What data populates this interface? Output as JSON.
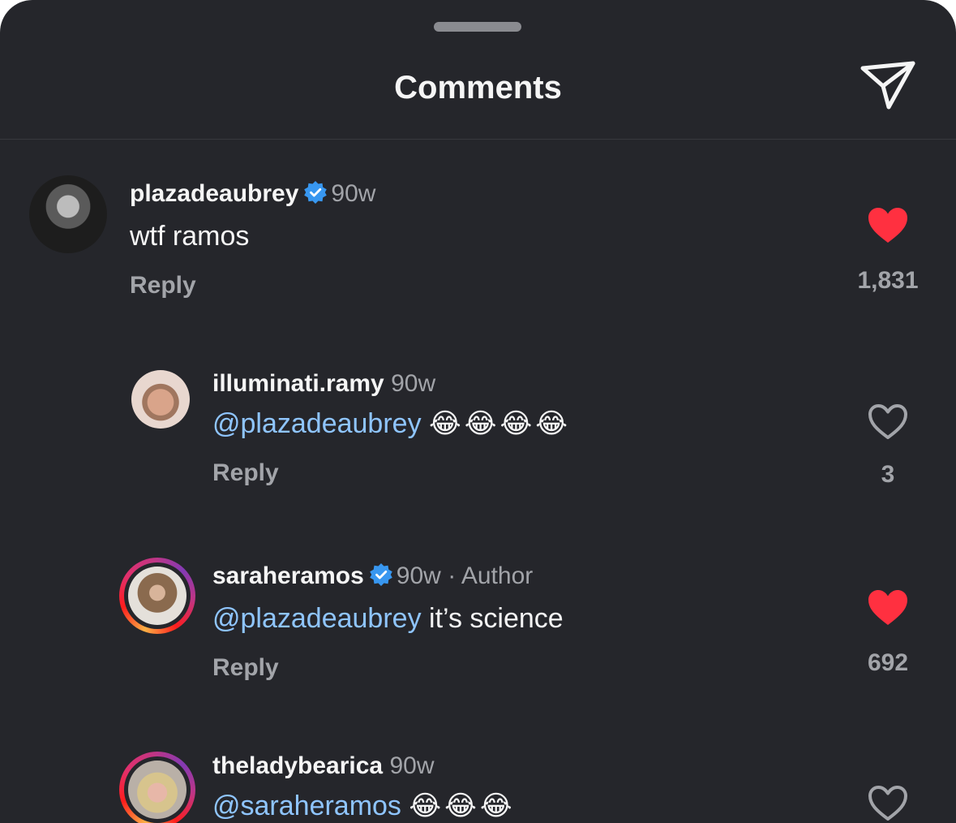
{
  "header": {
    "title": "Comments"
  },
  "comments": [
    {
      "username": "plazadeaubrey",
      "verified": true,
      "time": "90w",
      "text": "wtf ramos",
      "reply_label": "Reply",
      "liked": true,
      "like_count": "1,831"
    },
    {
      "username": "illuminati.ramy",
      "verified": false,
      "time": "90w",
      "mention": "@plazadeaubrey",
      "text": "😂😂😂😂",
      "reply_label": "Reply",
      "liked": false,
      "like_count": "3"
    },
    {
      "username": "saraheramos",
      "verified": true,
      "time": "90w",
      "author_tag": "· Author",
      "mention": "@plazadeaubrey",
      "text": "it’s science",
      "reply_label": "Reply",
      "liked": true,
      "like_count": "692"
    },
    {
      "username": "theladybearica",
      "verified": false,
      "time": "90w",
      "mention": "@saraheramos",
      "text": "😂😂😂",
      "liked": false
    }
  ],
  "icons": {
    "share": "paper-plane-icon",
    "verified": "verified-badge-icon",
    "heart_filled": "heart-filled-icon",
    "heart_outline": "heart-outline-icon"
  },
  "colors": {
    "background": "#25262b",
    "text": "#f5f5f5",
    "secondary": "#a2a4a9",
    "mention": "#8fc5ff",
    "verified": "#3897f0",
    "like": "#ff3040"
  }
}
